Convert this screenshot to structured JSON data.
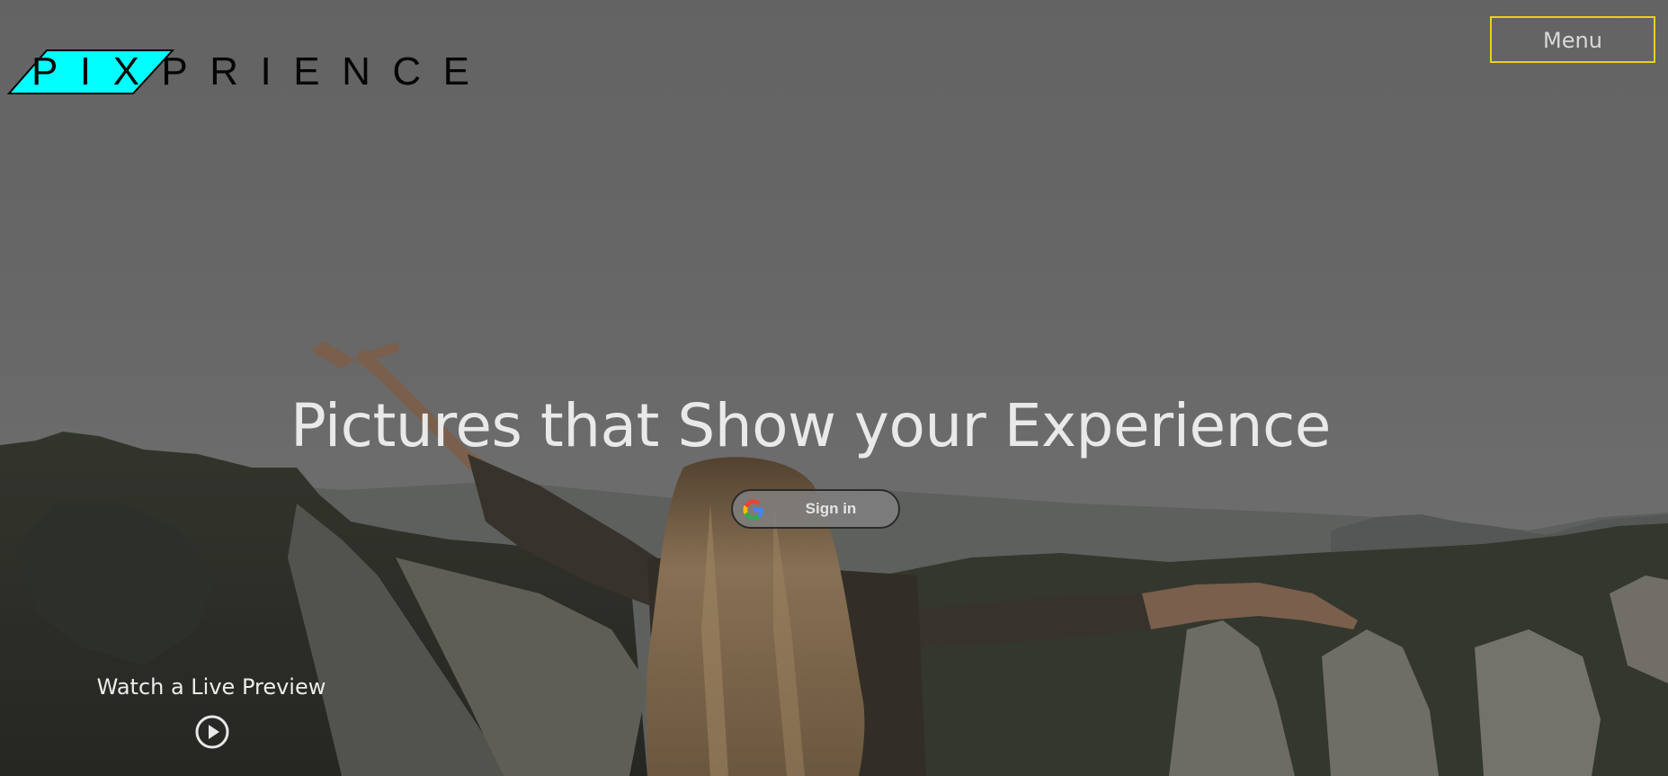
{
  "brand": {
    "name": "PIXPRIENCE",
    "accent_color": "#00ffff"
  },
  "header": {
    "menu_label": "Menu",
    "menu_border_color": "#e6d21d"
  },
  "hero": {
    "headline": "Pictures that Show your Experience",
    "background_description_icon": "mountain-woman-photo"
  },
  "signin": {
    "label": "Sign in",
    "icon": "google-g-icon"
  },
  "preview": {
    "label": "Watch a Live Preview",
    "icon": "play-circle-icon"
  }
}
